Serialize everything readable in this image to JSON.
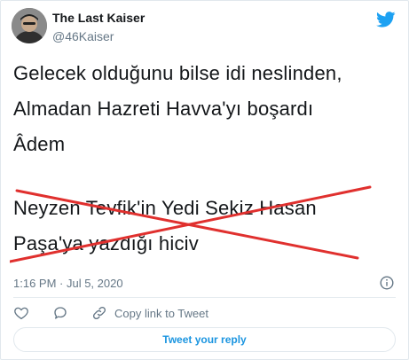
{
  "author": {
    "display_name": "The Last Kaiser",
    "handle": "@46Kaiser",
    "avatar_icon": "profile-photo"
  },
  "brand": {
    "icon": "twitter-bird-icon",
    "color": "#1da1f2"
  },
  "tweet": {
    "lines": [
      "Gelecek olduğunu bilse idi neslinden,",
      "Almadan Hazreti Havva'yı boşardı",
      "Âdem",
      "Neyzen Tevfik'in Yedi Sekiz Hasan",
      "Paşa'ya yazdığı hiciv"
    ],
    "strike_color": "#e0302e"
  },
  "meta": {
    "timestamp": "1:16 PM · Jul 5, 2020",
    "info_icon": "info-icon"
  },
  "actions": {
    "like_icon": "heart-icon",
    "comment_icon": "comment-icon",
    "copy_icon": "link-icon",
    "copy_label": "Copy link to Tweet"
  },
  "reply": {
    "label": "Tweet your reply",
    "accent": "#1b95e0"
  }
}
